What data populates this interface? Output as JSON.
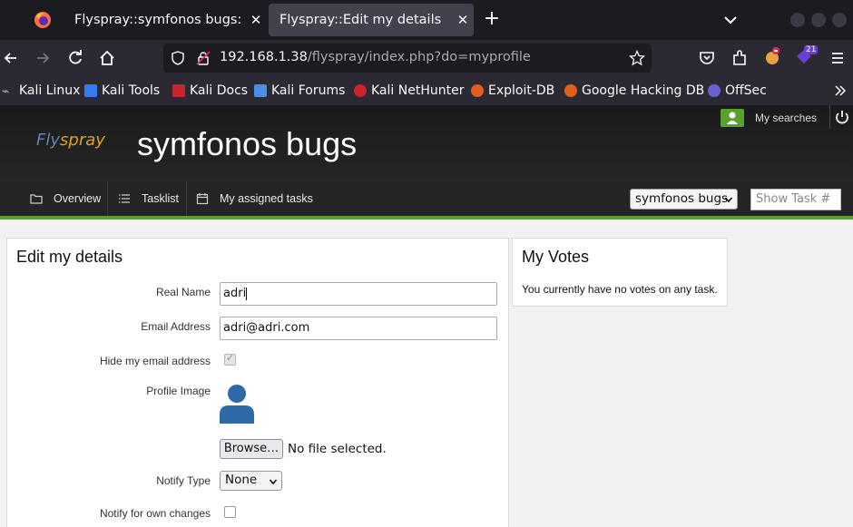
{
  "browser": {
    "tabs": [
      {
        "title": "Flyspray::symfonos bugs: Tas",
        "active": false
      },
      {
        "title": "Flyspray::Edit my details",
        "active": true
      }
    ],
    "url": {
      "host": "192.168.1.38",
      "path": "/flyspray/index.php?do=myprofile"
    },
    "extension_badge": "21",
    "bookmarks": [
      {
        "label": "Kali Linux",
        "icon": "kali-icon"
      },
      {
        "label": "Kali Tools",
        "icon": "kali-tools-icon"
      },
      {
        "label": "Kali Docs",
        "icon": "kali-docs-icon"
      },
      {
        "label": "Kali Forums",
        "icon": "kali-forums-icon"
      },
      {
        "label": "Kali NetHunter",
        "icon": "nethunter-icon"
      },
      {
        "label": "Exploit-DB",
        "icon": "exploitdb-icon"
      },
      {
        "label": "Google Hacking DB",
        "icon": "ghdb-icon"
      },
      {
        "label": "OffSec",
        "icon": "offsec-icon"
      }
    ]
  },
  "header": {
    "logo": {
      "fl": "Fly",
      "rest": "spray"
    },
    "project_title": "symfonos bugs",
    "my_searches": "My searches"
  },
  "menu": {
    "overview": "Overview",
    "tasklist": "Tasklist",
    "assigned": "My assigned tasks",
    "project_select": "symfonos bugs",
    "show_task_placeholder": "Show Task #"
  },
  "edit_box": {
    "title": "Edit my details",
    "real_name_label": "Real Name",
    "real_name_value": "adri",
    "email_label": "Email Address",
    "email_value": "adri@adri.com",
    "hide_email_label": "Hide my email address",
    "profile_image_label": "Profile Image",
    "browse_label": "Browse…",
    "no_file": "No file selected.",
    "notify_type_label": "Notify Type",
    "notify_type_value": "None",
    "notify_own_label": "Notify for own changes"
  },
  "votes_box": {
    "title": "My Votes",
    "text": "You currently have no votes on any task."
  },
  "colors": {
    "accent_green": "#5aa02c",
    "header_bg": "#1a1a1a",
    "browser_bg": "#2b2a33"
  }
}
